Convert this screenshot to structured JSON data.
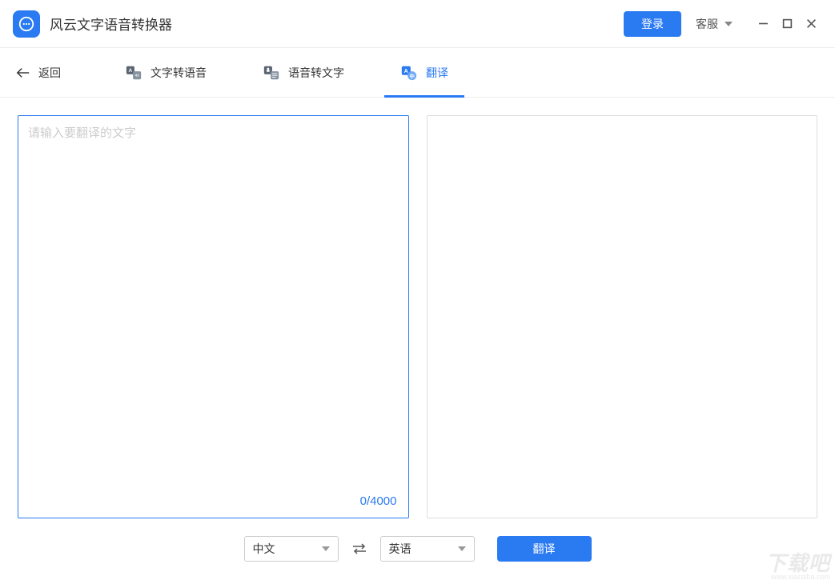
{
  "header": {
    "app_title": "风云文字语音转换器",
    "login_label": "登录",
    "service_label": "客服"
  },
  "nav": {
    "back_label": "返回",
    "tabs": [
      {
        "label": "文字转语音",
        "active": false
      },
      {
        "label": "语音转文字",
        "active": false
      },
      {
        "label": "翻译",
        "active": true
      }
    ]
  },
  "translate": {
    "input_placeholder": "请输入要翻译的文字",
    "char_count": "0/4000",
    "source_lang": "中文",
    "target_lang": "英语",
    "translate_button": "翻译"
  },
  "watermark": {
    "main": "下载吧",
    "sub": "www.xiazaiba.com"
  }
}
